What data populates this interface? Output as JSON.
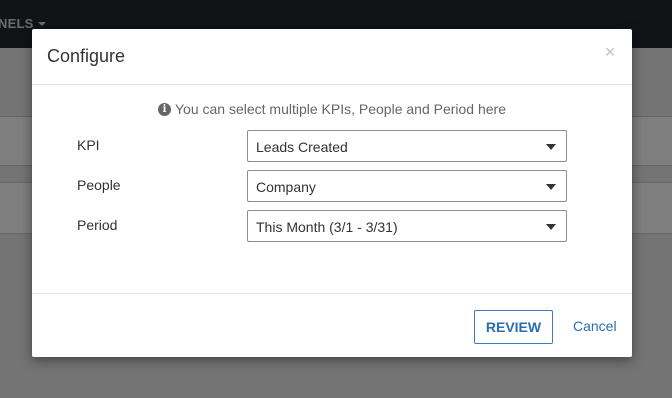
{
  "background": {
    "topbar_nav_label": "NELS"
  },
  "modal": {
    "title": "Configure",
    "close_symbol": "×",
    "info_icon": "info-circle-icon",
    "info_icon_glyph": "i",
    "info_text": "You can select multiple KPIs, People and Period here",
    "fields": [
      {
        "label": "KPI",
        "value": "Leads Created"
      },
      {
        "label": "People",
        "value": "Company"
      },
      {
        "label": "Period",
        "value": "This Month (3/1 - 3/31)"
      }
    ],
    "review_label": "REVIEW",
    "cancel_label": "Cancel"
  },
  "colors": {
    "link": "#2a6db0",
    "topbar": "#23262e"
  }
}
